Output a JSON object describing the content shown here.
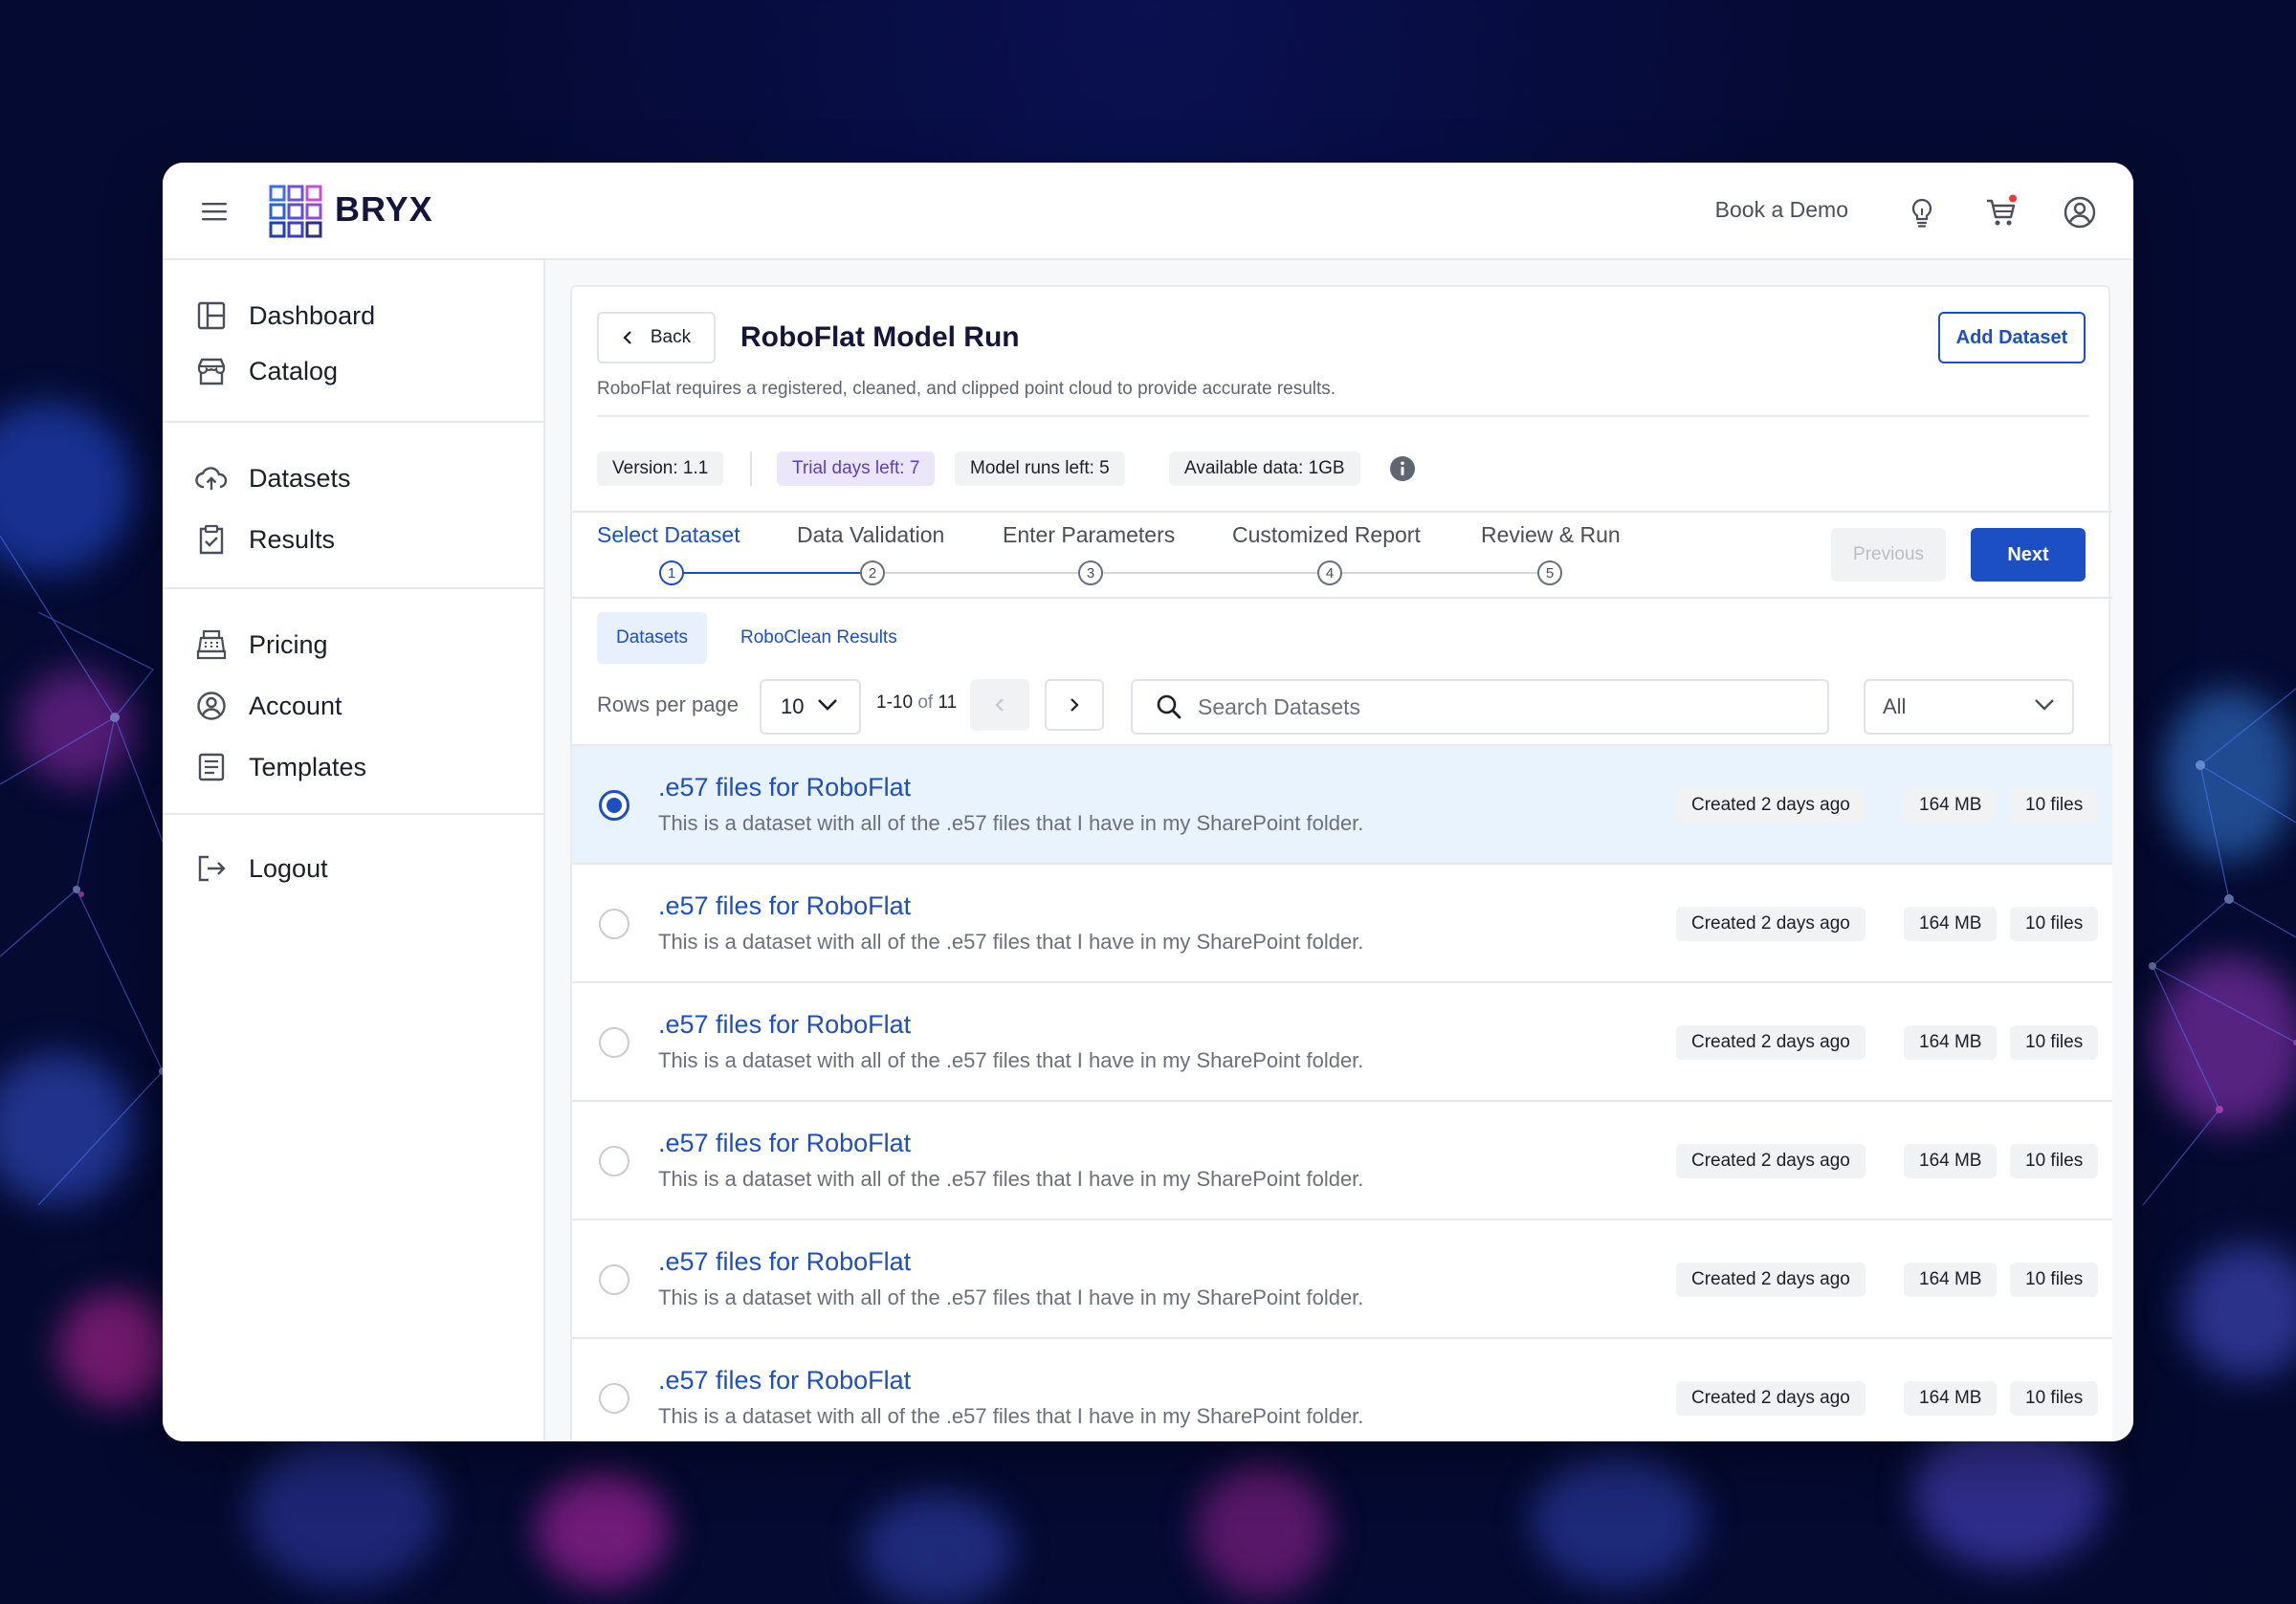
{
  "brand": {
    "name": "BRYX"
  },
  "header": {
    "book_demo": "Book a Demo"
  },
  "sidebar": {
    "groups": [
      [
        {
          "label": "Dashboard",
          "icon": "dashboard-icon"
        },
        {
          "label": "Catalog",
          "icon": "storefront-icon"
        }
      ],
      [
        {
          "label": "Datasets",
          "icon": "cloud-upload-icon"
        },
        {
          "label": "Results",
          "icon": "clipboard-check-icon"
        }
      ],
      [
        {
          "label": "Pricing",
          "icon": "cash-register-icon"
        },
        {
          "label": "Account",
          "icon": "user-circle-icon"
        },
        {
          "label": "Templates",
          "icon": "document-icon"
        }
      ],
      [
        {
          "label": "Logout",
          "icon": "logout-icon"
        }
      ]
    ]
  },
  "page": {
    "back_label": "Back",
    "title": "RoboFlat Model Run",
    "subtitle": "RoboFlat requires a registered, cleaned, and clipped point cloud to provide accurate results.",
    "add_dataset": "Add Dataset",
    "chips": {
      "version": "Version: 1.1",
      "trial": "Trial days left: 7",
      "runs": "Model runs left: 5",
      "data": "Available data: 1GB"
    }
  },
  "stepper": {
    "steps": [
      {
        "label": "Select Dataset",
        "num": "1"
      },
      {
        "label": "Data Validation",
        "num": "2"
      },
      {
        "label": "Enter Parameters",
        "num": "3"
      },
      {
        "label": "Customized Report",
        "num": "4"
      },
      {
        "label": "Review & Run",
        "num": "5"
      }
    ],
    "active_index": 0,
    "previous_label": "Previous",
    "next_label": "Next"
  },
  "subtabs": [
    "Datasets",
    "RoboClean Results"
  ],
  "table_controls": {
    "rows_label": "Rows per page",
    "rows_value": "10",
    "range": "1-10",
    "of": "of",
    "total": "11",
    "search_placeholder": "Search Datasets",
    "filter_value": "All"
  },
  "datasets": [
    {
      "title": ".e57 files for RoboFlat",
      "desc": "This is a dataset with all of the .e57 files that I have in my SharePoint folder.",
      "created": "Created 2 days ago",
      "size": "164 MB",
      "files": "10 files",
      "selected": true
    },
    {
      "title": ".e57 files for RoboFlat",
      "desc": "This is a dataset with all of the .e57 files that I have in my SharePoint folder.",
      "created": "Created 2 days ago",
      "size": "164 MB",
      "files": "10 files",
      "selected": false
    },
    {
      "title": ".e57 files for RoboFlat",
      "desc": "This is a dataset with all of the .e57 files that I have in my SharePoint folder.",
      "created": "Created 2 days ago",
      "size": "164 MB",
      "files": "10 files",
      "selected": false
    },
    {
      "title": ".e57 files for RoboFlat",
      "desc": "This is a dataset with all of the .e57 files that I have in my SharePoint folder.",
      "created": "Created 2 days ago",
      "size": "164 MB",
      "files": "10 files",
      "selected": false
    },
    {
      "title": ".e57 files for RoboFlat",
      "desc": "This is a dataset with all of the .e57 files that I have in my SharePoint folder.",
      "created": "Created 2 days ago",
      "size": "164 MB",
      "files": "10 files",
      "selected": false
    },
    {
      "title": ".e57 files for RoboFlat",
      "desc": "This is a dataset with all of the .e57 files that I have in my SharePoint folder.",
      "created": "Created 2 days ago",
      "size": "164 MB",
      "files": "10 files",
      "selected": false
    }
  ],
  "colors": {
    "accent": "#1d4fc4",
    "selected_row": "#e9f3fd",
    "trial_chip": "#ece6fb",
    "background": "#050a35"
  }
}
